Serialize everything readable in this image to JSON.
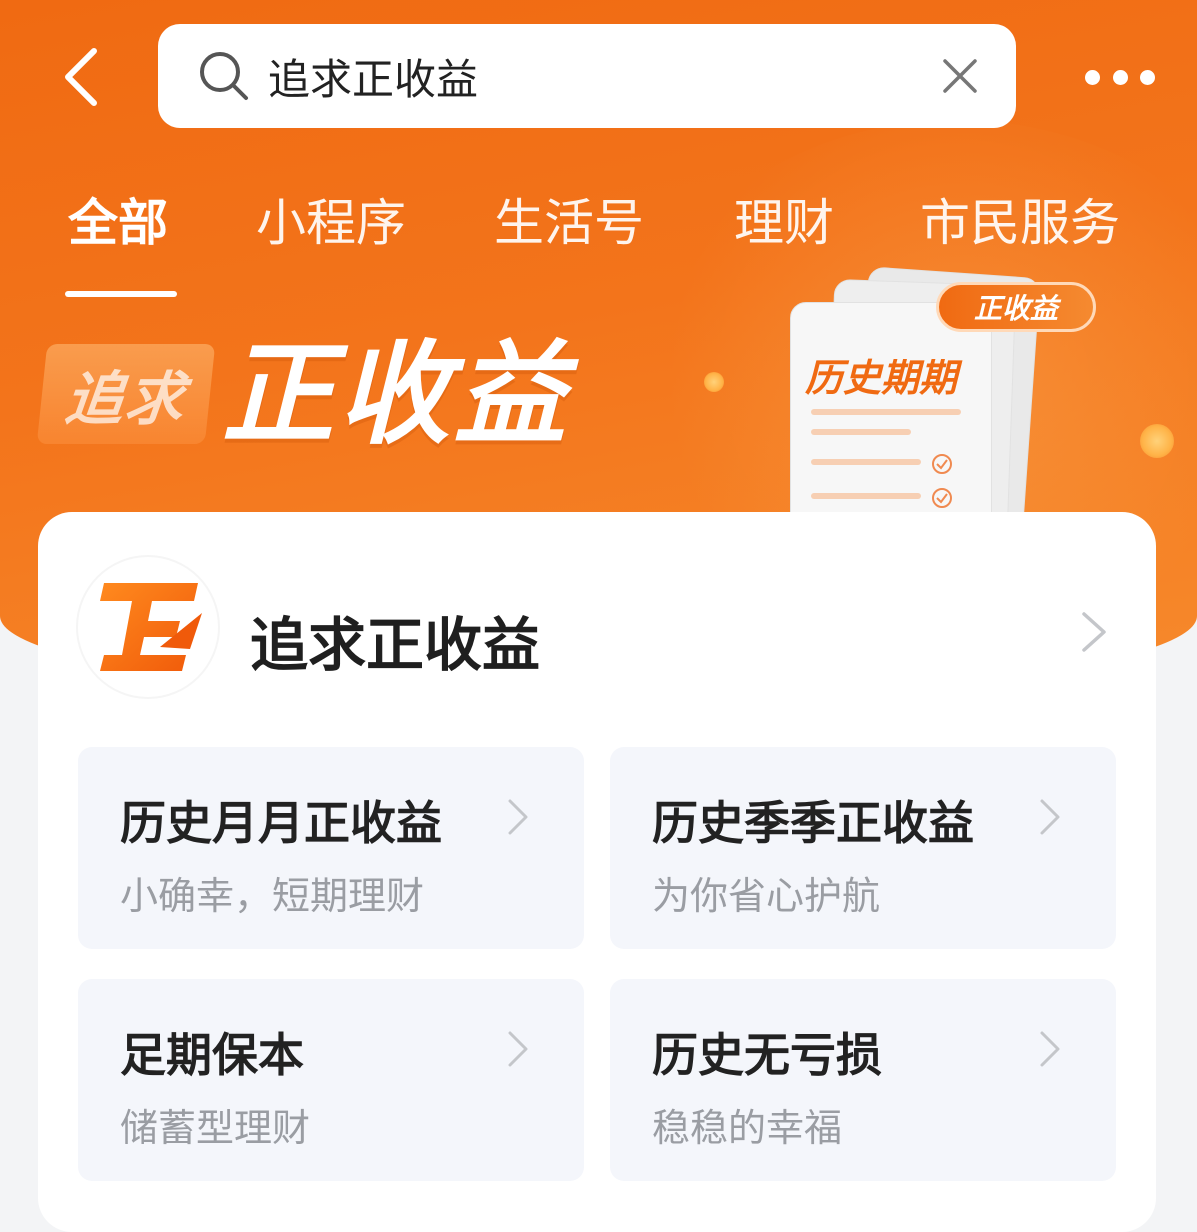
{
  "search": {
    "value": "追求正收益"
  },
  "tabs": [
    {
      "label": "全部",
      "active": true
    },
    {
      "label": "小程序",
      "active": false
    },
    {
      "label": "生活号",
      "active": false
    },
    {
      "label": "理财",
      "active": false
    },
    {
      "label": "市民服务",
      "active": false
    }
  ],
  "banner": {
    "tag": "追求",
    "title": "正收益",
    "doc_title": "历史期期",
    "doc_badge": "正收益"
  },
  "card": {
    "title": "追求正收益",
    "tiles": [
      {
        "title": "历史月月正收益",
        "subtitle": "小确幸，短期理财"
      },
      {
        "title": "历史季季正收益",
        "subtitle": "为你省心护航"
      },
      {
        "title": "足期保本",
        "subtitle": "储蓄型理财"
      },
      {
        "title": "历史无亏损",
        "subtitle": "稳稳的幸福"
      }
    ]
  },
  "icons": {
    "back": "back-arrow-icon",
    "search": "search-icon",
    "clear": "close-icon",
    "more": "more-dots-icon",
    "chevron": "chevron-right-icon",
    "logo": "brand-logo-icon"
  },
  "colors": {
    "brand_orange": "#f06a12",
    "tile_bg": "#f4f6fb",
    "subtitle_gray": "#9a9da3"
  }
}
